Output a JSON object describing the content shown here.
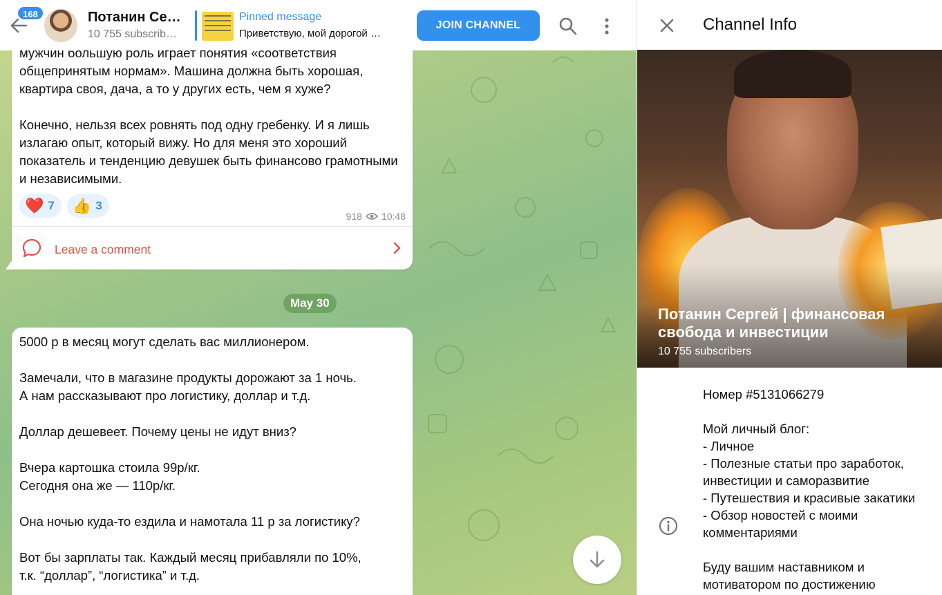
{
  "header": {
    "unread_count": "168",
    "title": "Потанин Се…",
    "subtitle": "10 755 subscrib…",
    "pinned_label": "Pinned message",
    "pinned_text": "Приветствую, мой дорогой …",
    "join_label": "JOIN CHANNEL"
  },
  "messages": [
    {
      "text": "мужчин большую роль играет понятия «соответствия общепринятым нормам». Машина должна быть хорошая, квартира своя, дача, а то у других есть, чем я хуже?\n\nКонечно, нельзя всех ровнять под одну гребенку. И я лишь излагаю опыт, который вижу. Но для меня это хороший показатель и тенденцию девушек быть финансово грамотными и независимыми.",
      "reactions": [
        {
          "emoji": "❤️",
          "count": "7"
        },
        {
          "emoji": "👍",
          "count": "3"
        }
      ],
      "views": "918",
      "time": "10:48",
      "comment_label": "Leave a comment"
    },
    {
      "text": "5000 р в месяц могут сделать вас миллионером.\n\nЗамечали, что в магазине продукты дорожают за 1 ночь.\nА нам рассказывают про логистику, доллар и т.д.\n\nДоллар дешевеет. Почему цены не идут вниз?\n\nВчера картошка стоила 99р/кг.\nСегодня она же — 110р/кг.\n\nОна ночью куда-то ездила и намотала 11 р за логистику?\n\nВот бы зарплаты так. Каждый месяц прибавляли по 10%,\nт.к. “доллар”, “логистика” и т.д."
    }
  ],
  "date_separator": "May 30",
  "info": {
    "title": "Channel Info",
    "channel_name": "Потанин Сергей | финансовая свобода и инвестиции",
    "subscribers": "10 755 subscribers",
    "about": "Номер #5131066279\n\nМой личный блог:\n- Личное\n- Полезные статьи про заработок, инвестиции и саморазвитие\n- Путешествия и красивые закатики\n- Обзор новостей с моими комментариями\n\nБуду вашим наставником и мотиватором по достижению"
  },
  "colors": {
    "accent": "#3390ec",
    "comment": "#e0533f"
  }
}
